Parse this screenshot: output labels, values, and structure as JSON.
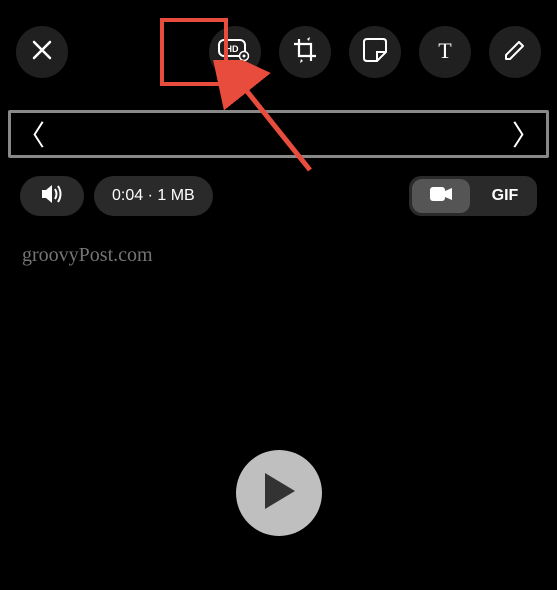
{
  "toolbar": {
    "close": "close",
    "hd": "hd-quality",
    "crop": "crop-rotate",
    "sticker": "sticker",
    "text": "text",
    "draw": "draw"
  },
  "timeline": {
    "left_handle": "〈",
    "right_handle": "〉"
  },
  "info": {
    "duration_size": "0:04 · 1 MB"
  },
  "format": {
    "video": "video",
    "gif": "GIF"
  },
  "watermark": "groovyPost.com",
  "annotation": {
    "highlight_color": "#e74c3c"
  }
}
